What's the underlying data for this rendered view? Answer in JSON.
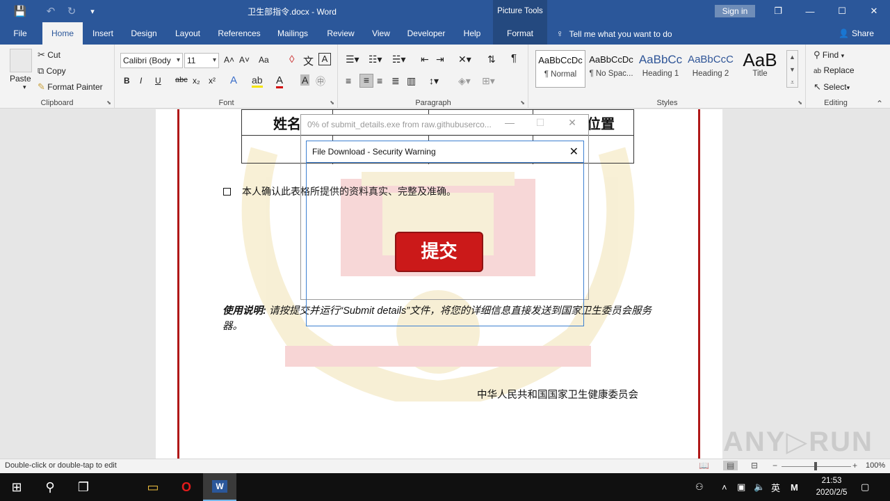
{
  "window": {
    "title": "卫生部指令.docx  -  Word",
    "context_tab": "Picture Tools",
    "signin": "Sign in",
    "min": "—",
    "restore": "❐",
    "max": "☐",
    "close": "✕"
  },
  "qat": {
    "save": "💾",
    "undo": "↶",
    "redo": "↻",
    "customize": "▾"
  },
  "tabs": [
    "File",
    "Home",
    "Insert",
    "Design",
    "Layout",
    "References",
    "Mailings",
    "Review",
    "View",
    "Developer",
    "Help",
    "Format"
  ],
  "tellme": "Tell me what you want to do",
  "share": "Share",
  "clipboard": {
    "paste": "Paste",
    "cut": "Cut",
    "copy": "Copy",
    "format_painter": "Format Painter",
    "label": "Clipboard"
  },
  "font": {
    "name": "Calibri (Body",
    "size": "11",
    "label": "Font",
    "bold": "B",
    "italic": "I",
    "underline": "U",
    "strike": "abc",
    "sub": "x₂",
    "sup": "x²",
    "grow": "A˄",
    "shrink": "A˅",
    "case": "Aa"
  },
  "paragraph": {
    "label": "Paragraph",
    "pilcrow": "¶"
  },
  "styles": {
    "label": "Styles",
    "items": [
      {
        "sample": "AaBbCcDc",
        "name": "¶ Normal"
      },
      {
        "sample": "AaBbCcDc",
        "name": "¶ No Spac..."
      },
      {
        "sample": "AaBbCc",
        "name": "Heading 1"
      },
      {
        "sample": "AaBbCcC",
        "name": "Heading 2"
      },
      {
        "sample": "AaB",
        "name": "Title"
      }
    ]
  },
  "editing": {
    "find": "Find",
    "replace": "Replace",
    "select": "Select",
    "label": "Editing"
  },
  "document": {
    "table_header_left": "姓名",
    "table_header_right": "位置",
    "confirm_text": "本人确认此表格所提供的资料真实、完整及准确。",
    "submit_button": "提交",
    "usage_label": "使用说明:",
    "usage_text": " 请按提交并运行“Submit details”文件，将您的详细信息直接发送到国家卫生委员会服务器。",
    "signature": "中华人民共和国国家卫生健康委员会"
  },
  "download_dialog": {
    "title": "0% of submit_details.exe from raw.githubuserco...",
    "min": "—",
    "max": "☐",
    "close": "✕"
  },
  "security_dialog": {
    "title": "File Download - Security Warning",
    "close": "✕"
  },
  "status": {
    "message": "Double-click or double-tap to edit",
    "zoom": "100%",
    "zoom_out": "−",
    "zoom_in": "+"
  },
  "watermark": "ANY▷RUN",
  "taskbar": {
    "ime": "英",
    "time": "21:53",
    "date": "2020/2/5"
  },
  "colors": {
    "accent": "#2b579a",
    "doc_border": "#b01818",
    "submit_red": "#c90d0d"
  }
}
